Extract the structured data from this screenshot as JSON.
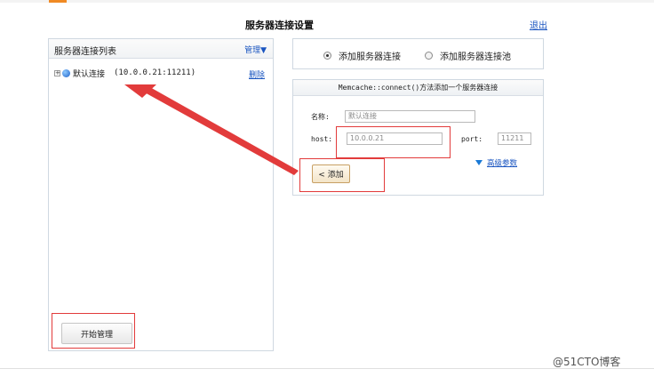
{
  "header": {
    "title": "服务器连接设置",
    "logout": "退出"
  },
  "left_panel": {
    "title": "服务器连接列表",
    "manage": "管理▼",
    "tree": [
      {
        "expand": "+",
        "name": "默认连接",
        "address": "(10.0.0.21:11211)",
        "delete": "删除"
      }
    ],
    "start_button": "开始管理"
  },
  "mode": {
    "options": [
      "添加服务器连接",
      "添加服务器连接池"
    ],
    "selected": "添加服务器连接"
  },
  "form": {
    "header": "Memcache::connect()方法添加一个服务器连接",
    "name_label": "名称:",
    "name_value": "默认连接",
    "host_label": "host:",
    "host_value": "10.0.0.21",
    "port_label": "port:",
    "port_value": "11211",
    "advanced": "高级参数",
    "add_button": "< 添加"
  },
  "watermark": "@51CTO博客",
  "colors": {
    "link": "#1a55c0",
    "annotation_red": "#e23b3b",
    "border": "#cfd8e1"
  }
}
